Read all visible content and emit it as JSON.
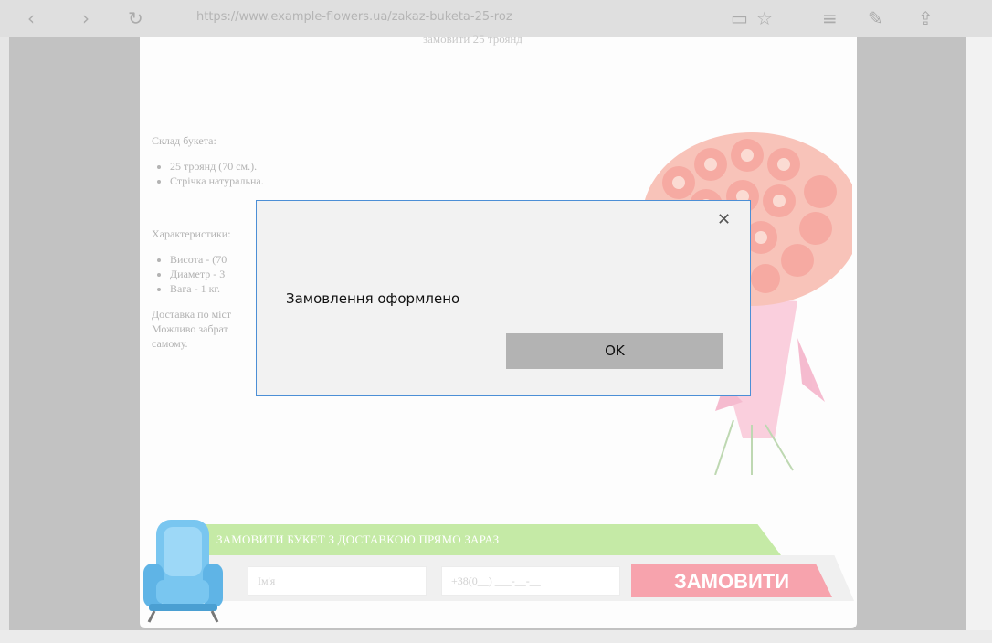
{
  "browser": {
    "back_icon": "‹",
    "forward_icon": "›",
    "url_text": "https://www.example-flowers.ua/zakaz-buketa-25-roz"
  },
  "page": {
    "truncated_heading": "замовити 25 троянд",
    "composition_title": "Склад букета:",
    "composition_items": [
      "25 троянд (70 см.).",
      "Стрічка натуральна."
    ],
    "characteristics_title": "Характеристики:",
    "characteristics_items": [
      "Висота - (70",
      "Диаметр - 3",
      "Вага - 1 кг."
    ],
    "delivery_text": [
      "Доставка по міст",
      "Можливо забрат",
      "самому."
    ],
    "banner_text": "ЗАМОВИТИ БУКЕТ З ДОСТАВКОЮ ПРЯМО ЗАРАЗ",
    "name_placeholder": "Ім'я",
    "phone_placeholder": "+38(0__) ___-__-__",
    "order_button": "ЗАМОВИТИ"
  },
  "dialog": {
    "message": "Замовлення оформлено",
    "ok_label": "OK",
    "close_icon": "✕"
  },
  "colors": {
    "dialog_border": "#4c8fd6",
    "order_button": "#f7a3ad",
    "banner": "#c5eaa6"
  }
}
